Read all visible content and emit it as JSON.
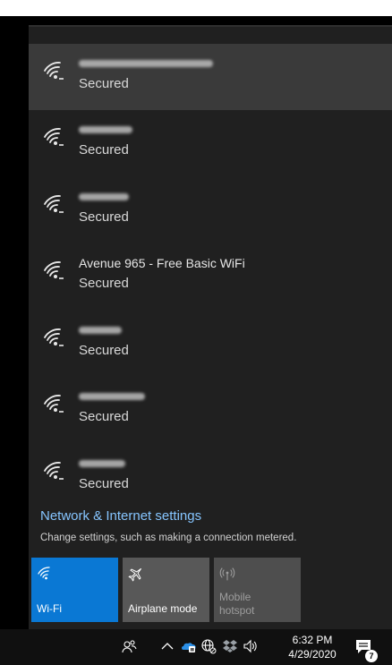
{
  "networks": [
    {
      "name": "",
      "status": "Secured",
      "selected": true
    },
    {
      "name": "",
      "status": "Secured"
    },
    {
      "name": "",
      "status": "Secured"
    },
    {
      "name": "Avenue 965 - Free Basic WiFi",
      "status": "Secured"
    },
    {
      "name": "",
      "status": "Secured"
    },
    {
      "name": "",
      "status": "Secured"
    },
    {
      "name": "",
      "status": "Secured"
    }
  ],
  "settings": {
    "link": "Network & Internet settings",
    "description": "Change settings, such as making a connection metered."
  },
  "tiles": {
    "wifi": {
      "label": "Wi-Fi",
      "icon": "wifi-icon"
    },
    "airplane": {
      "label": "Airplane mode",
      "icon": "airplane-icon"
    },
    "hotspot": {
      "label_line1": "Mobile",
      "label_line2": "hotspot",
      "icon": "hotspot-icon"
    }
  },
  "taskbar": {
    "time": "6:32 PM",
    "date": "4/29/2020",
    "notification_count": "7"
  },
  "colors": {
    "accent": "#0a78d4",
    "link": "#86c5ff",
    "panel": "#202020"
  }
}
